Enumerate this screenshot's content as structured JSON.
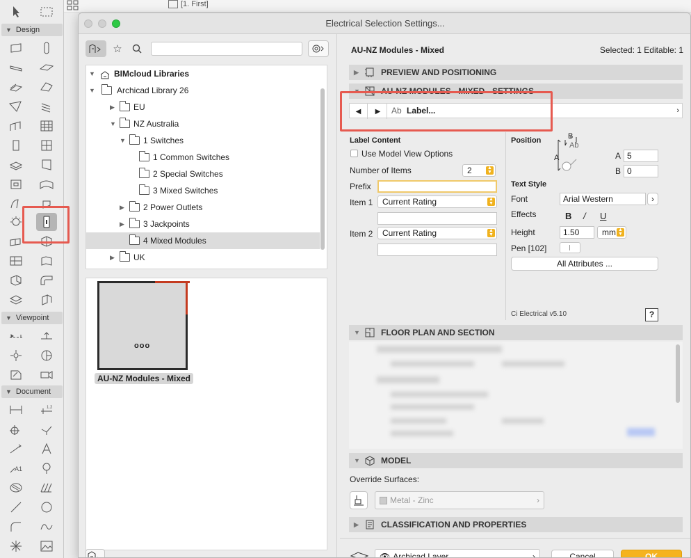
{
  "background": {
    "tab_label": "[1. First]"
  },
  "toolbox": {
    "sections": [
      "Design",
      "Viewpoint",
      "Document"
    ]
  },
  "dialog": {
    "title": "Electrical Selection Settings...",
    "search": {
      "placeholder": ""
    },
    "tree": [
      {
        "label": "BIMcloud Libraries",
        "bold": true
      },
      {
        "label": "Archicad Library 26"
      },
      {
        "label": "EU"
      },
      {
        "label": "NZ Australia"
      },
      {
        "label": "1 Switches"
      },
      {
        "label": "1 Common Switches"
      },
      {
        "label": "2 Special Switches"
      },
      {
        "label": "3 Mixed Switches"
      },
      {
        "label": "2 Power Outlets"
      },
      {
        "label": "3 Jackpoints"
      },
      {
        "label": "4 Mixed Modules",
        "selected": true
      },
      {
        "label": "UK"
      }
    ],
    "preview": {
      "label": "AU-NZ Modules - Mixed",
      "dots": "ooo"
    },
    "header": {
      "object_name": "AU-NZ Modules - Mixed",
      "selection_info": "Selected: 1 Editable: 1"
    },
    "sections": {
      "preview_positioning": "PREVIEW AND POSITIONING",
      "settings": "AU-NZ MODULES - MIXED - SETTINGS",
      "floor_plan": "FLOOR PLAN AND SECTION",
      "model": "MODEL",
      "classification": "CLASSIFICATION AND PROPERTIES"
    },
    "nav": {
      "page_prefix": "Ab",
      "page_label": "Label..."
    },
    "label_content": {
      "heading": "Label Content",
      "use_model_view": "Use Model View Options",
      "use_model_view_checked": false,
      "number_of_items_label": "Number of Items",
      "number_of_items": "2",
      "prefix_label": "Prefix",
      "prefix_value": "",
      "item1_label": "Item 1",
      "item1_value": "Current Rating",
      "item1_extra": "",
      "item2_label": "Item 2",
      "item2_value": "Current Rating",
      "item2_extra": ""
    },
    "position": {
      "heading": "Position",
      "diagram_b": "B",
      "diagram_ab": "Ab",
      "diagram_a": "A",
      "a_label": "A",
      "a_value": "5",
      "b_label": "B",
      "b_value": "0"
    },
    "text_style": {
      "heading": "Text Style",
      "font_label": "Font",
      "font_value": "Arial Western",
      "effects_label": "Effects",
      "effect_bold": "B",
      "effect_italic": "/",
      "effect_underline": "U",
      "height_label": "Height",
      "height_value": "1.50",
      "height_unit": "mm",
      "pen_label": "Pen [102]",
      "all_attributes": "All Attributes ..."
    },
    "version": "Ci Electrical v5.10",
    "help": "?",
    "model": {
      "override_label": "Override Surfaces:",
      "surface_value": "Metal - Zinc"
    },
    "footer": {
      "layer": "Archicad Layer",
      "cancel": "Cancel",
      "ok": "OK"
    },
    "colors": {
      "highlight": "#e65a50",
      "accent": "#f0b21e",
      "preview_red": "#c43b20"
    }
  }
}
